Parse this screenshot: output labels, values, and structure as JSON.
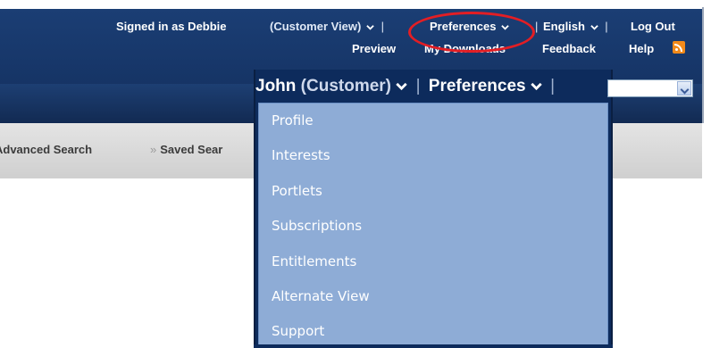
{
  "topnav": {
    "signed_in": "Signed in as Debbie",
    "view": "(Customer View)",
    "preferences": "Preferences",
    "language": "English",
    "logout": "Log Out"
  },
  "secondnav": {
    "preview": "Preview",
    "downloads": "My Downloads",
    "feedback": "Feedback",
    "help": "Help"
  },
  "tabs": {
    "advanced_search": "Advanced Search",
    "saved_search": "Saved Sear"
  },
  "zoom": {
    "user": "John",
    "role": "(Customer)",
    "preferences": "Preferences"
  },
  "menu": {
    "items": [
      "Profile",
      "Interests",
      "Portlets",
      "Subscriptions",
      "Entitlements",
      "Alternate View",
      "Support"
    ]
  },
  "colors": {
    "header_blue": "#17376a",
    "menu_blue": "#8eacd6",
    "annotation_red": "#e31e24",
    "rss_orange": "#f28a1a"
  }
}
